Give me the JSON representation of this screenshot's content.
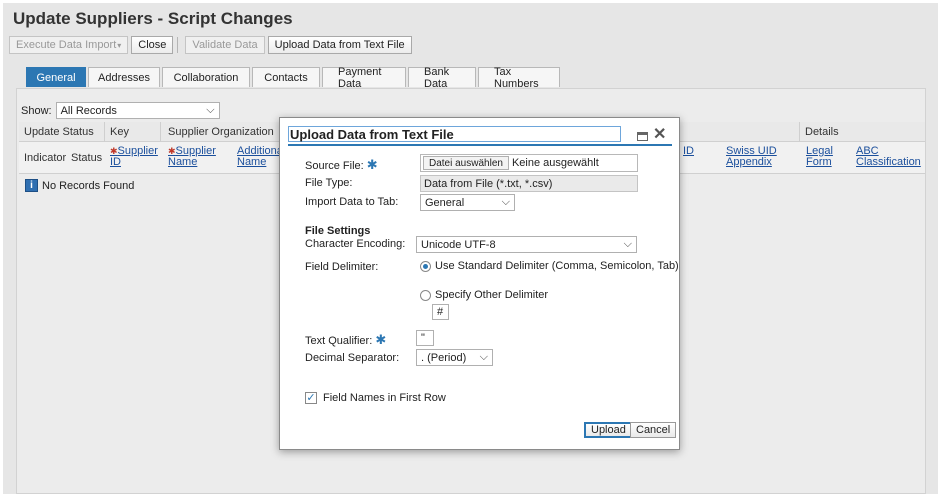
{
  "page": {
    "title": "Update Suppliers - Script Changes"
  },
  "toolbar": {
    "execute": "Execute Data Import",
    "close": "Close",
    "validate": "Validate Data",
    "upload": "Upload Data from Text File"
  },
  "tabs": [
    "General",
    "Addresses",
    "Collaboration",
    "Contacts",
    "Payment Data",
    "Bank Data",
    "Tax Numbers"
  ],
  "filter": {
    "label": "Show:",
    "value": "All Records"
  },
  "grid": {
    "groups": {
      "update_status": "Update Status",
      "key": "Key",
      "supplier_org": "Supplier Organization",
      "details": "Details"
    },
    "cols": {
      "indicator": "Indicator",
      "status": "Status",
      "supplier_id_1": "Supplier",
      "supplier_id_2": "ID",
      "supplier_name_1": "Supplier",
      "supplier_name_2": "Name",
      "additional_name_1": "Additional",
      "additional_name_2": "Name",
      "id_fragment": "ID",
      "swiss_uid_1": "Swiss UID",
      "swiss_uid_2": "Appendix",
      "legal_form_1": "Legal",
      "legal_form_2": "Form",
      "abc_1": "ABC",
      "abc_2": "Classification"
    },
    "empty_message": "No Records Found"
  },
  "dialog": {
    "title": "Upload Data from Text File",
    "source_file_label": "Source File:",
    "file_button": "Datei auswählen",
    "file_status": "Keine ausgewählt",
    "file_type_label": "File Type:",
    "file_type_value": "Data from File (*.txt, *.csv)",
    "import_tab_label": "Import Data to Tab:",
    "import_tab_value": "General",
    "settings_heading": "File Settings",
    "encoding_label": "Character Encoding:",
    "encoding_value": "Unicode UTF-8",
    "delimiter_label": "Field Delimiter:",
    "delimiter_standard": "Use Standard Delimiter (Comma, Semicolon, Tab)",
    "delimiter_other": "Specify Other Delimiter",
    "delimiter_other_value": "#",
    "qualifier_label": "Text Qualifier:",
    "qualifier_value": "\"",
    "decimal_label": "Decimal Separator:",
    "decimal_value": ". (Period)",
    "field_names_label": "Field Names in First Row",
    "upload_button": "Upload",
    "cancel_button": "Cancel"
  },
  "icons": {
    "info": "info-icon",
    "maximize": "maximize-icon",
    "close": "close-icon",
    "required": "asterisk-icon"
  },
  "colors": {
    "accent": "#2c77b3",
    "link": "#1b4f9c"
  }
}
